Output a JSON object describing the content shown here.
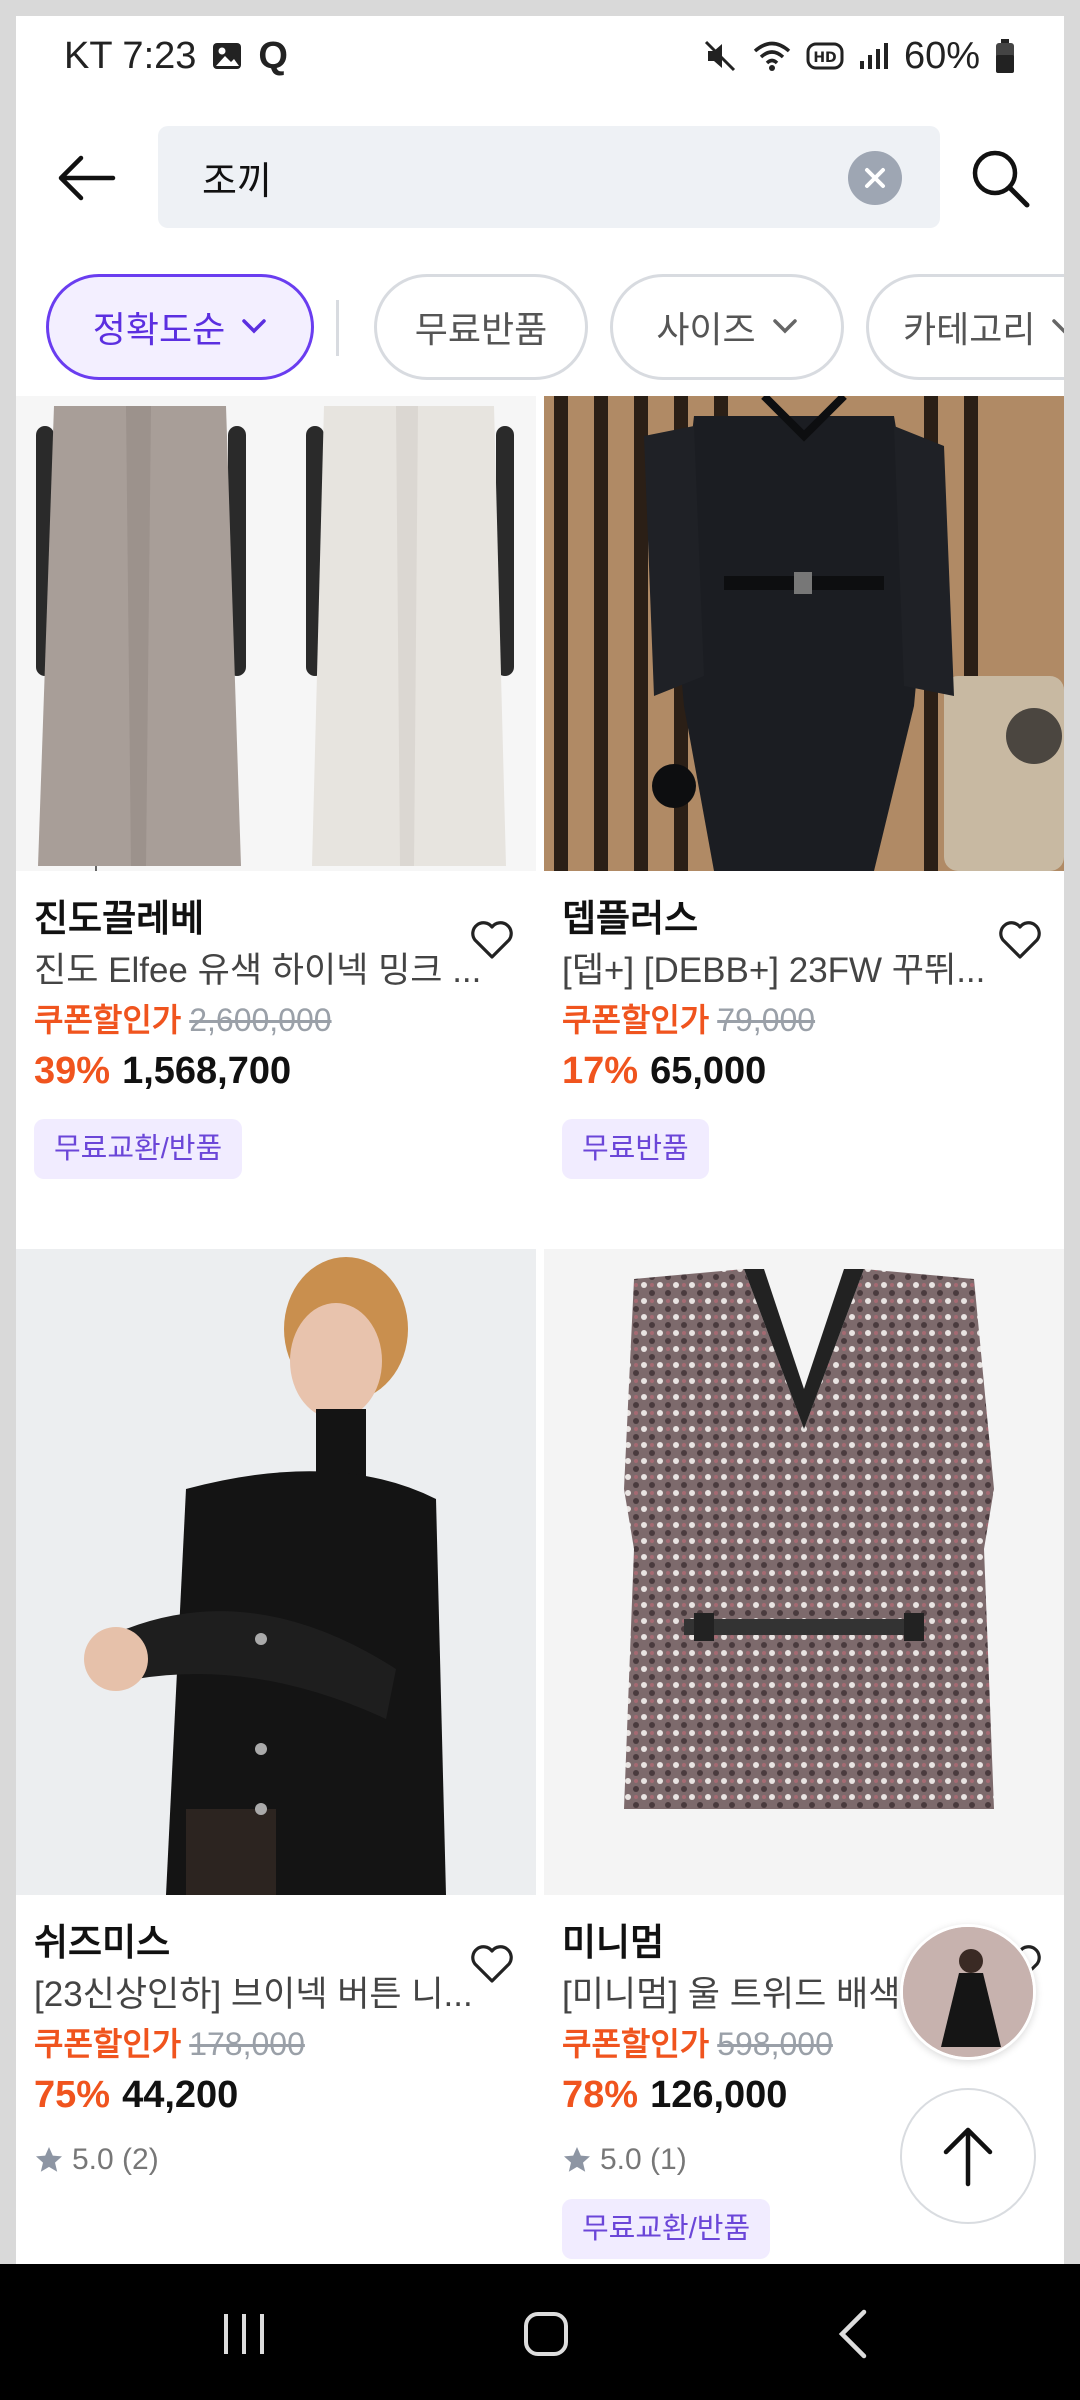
{
  "status_bar": {
    "carrier_time": "KT 7:23",
    "battery": "60%",
    "icons": [
      "gallery-icon",
      "q-icon",
      "mute-icon",
      "wifi-icon",
      "hd-icon",
      "signal-icon",
      "battery-icon"
    ]
  },
  "search": {
    "query": "조끼"
  },
  "filters": [
    {
      "label": "정확도순",
      "active": true,
      "has_chevron": true
    },
    {
      "label": "무료반품",
      "active": false,
      "has_chevron": false
    },
    {
      "label": "사이즈",
      "active": false,
      "has_chevron": true
    },
    {
      "label": "카테고리",
      "active": false,
      "has_chevron": true
    }
  ],
  "products": [
    {
      "brand": "진도끌레베",
      "title": "진도 Elfee 유색 하이넥 밍크 ...",
      "coupon_label": "쿠폰할인가",
      "original_price": "2,600,000",
      "discount": "39%",
      "price": "1,568,700",
      "badge": "무료교환/반품"
    },
    {
      "brand": "뎁플러스",
      "title": "[뎁+] [DEBB+] 23FW 꾸뛰...",
      "coupon_label": "쿠폰할인가",
      "original_price": "79,000",
      "discount": "17%",
      "price": "65,000",
      "badge": "무료반품"
    },
    {
      "brand": "쉬즈미스",
      "title": "[23신상인하] 브이넥 버튼 니...",
      "coupon_label": "쿠폰할인가",
      "original_price": "178,000",
      "discount": "75%",
      "price": "44,200",
      "rating": "5.0 (2)"
    },
    {
      "brand": "미니멈",
      "title": "[미니멈] 울 트위드 배색",
      "coupon_label": "쿠폰할인가",
      "original_price": "598,000",
      "discount": "78%",
      "price": "126,000",
      "rating": "5.0 (1)",
      "badge": "무료교환/반품"
    }
  ],
  "colors": {
    "accent": "#5b2fe0",
    "discount": "#f0541e",
    "badge_bg": "#f1ecff"
  }
}
